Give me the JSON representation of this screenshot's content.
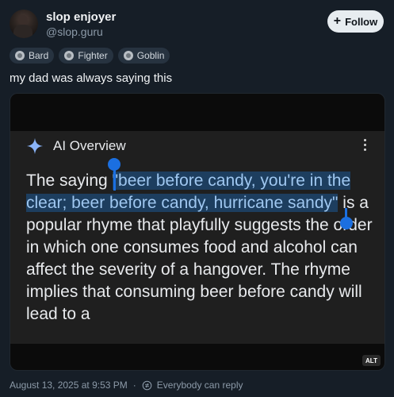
{
  "author": {
    "display_name": "slop enjoyer",
    "handle": "@slop.guru",
    "follow_label": "Follow"
  },
  "tags": [
    "Bard",
    "Fighter",
    "Goblin"
  ],
  "post": {
    "text": "my dad was always saying this"
  },
  "screenshot": {
    "header_title": "AI Overview",
    "text_before": "The saying ",
    "text_selected": "\"beer before candy, you're in the clear; beer before candy, hurricane sandy\"",
    "text_after": " is a popular rhyme that playfully suggests the order in which one consumes food and alcohol can affect the severity of a hangover. The rhyme implies that consuming beer before candy will lead to a",
    "alt_badge": "ALT",
    "colors": {
      "selection": "#1d3e5f",
      "handle": "#1b6fe0",
      "sparkle": "#8ab4f8"
    }
  },
  "footer": {
    "timestamp": "August 13, 2025 at 9:53 PM",
    "separator": "·",
    "reply_setting": "Everybody can reply"
  }
}
